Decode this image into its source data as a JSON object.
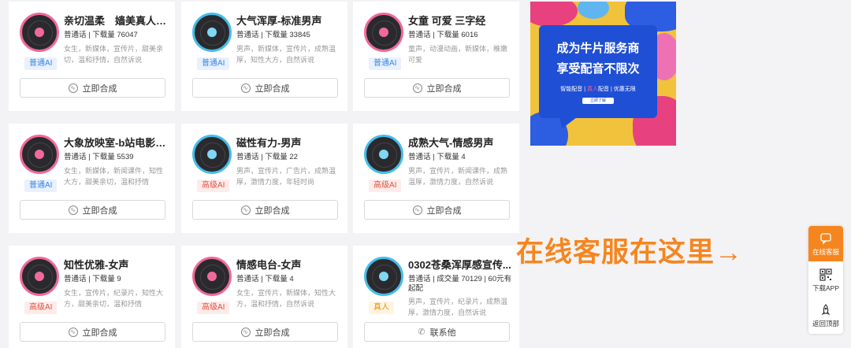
{
  "cards": [
    {
      "title": "亲切温柔　嫱美真人主播",
      "meta": "普通话 | 下载量 76047",
      "tags": "女生，新媒体，宣传片，甜美亲切，温和抒情，自然诉说",
      "badge": "普通AI",
      "badge_type": "normal",
      "ring": "pink",
      "button": "立即合成",
      "button_icon": "wave-icon"
    },
    {
      "title": "大气浑厚-标准男声",
      "meta": "普通话 | 下载量 33845",
      "tags": "男声，新媒体，宣传片，成熟温厚，知性大方，自然诉说",
      "badge": "普通AI",
      "badge_type": "normal",
      "ring": "blue",
      "button": "立即合成",
      "button_icon": "wave-icon"
    },
    {
      "title": "女童 可爱 三字经",
      "meta": "普通话 | 下载量 6016",
      "tags": "童声，动漫动画，新媒体，稚嫩可爱",
      "badge": "普通AI",
      "badge_type": "normal",
      "ring": "pink",
      "button": "立即合成",
      "button_icon": "wave-icon"
    },
    {
      "title": "大象放映室-b站电影解说",
      "meta": "普通话 | 下载量 5539",
      "tags": "女生，新媒体，新闻课件，知性大方，甜美亲切，温和抒情",
      "badge": "普通AI",
      "badge_type": "normal",
      "ring": "pink",
      "button": "立即合成",
      "button_icon": "wave-icon"
    },
    {
      "title": "磁性有力-男声",
      "meta": "普通话 | 下载量 22",
      "tags": "男声，宣传片，广告片，成熟温厚，激情力度，年轻时尚",
      "badge": "高级AI",
      "badge_type": "premium",
      "ring": "blue",
      "button": "立即合成",
      "button_icon": "wave-icon"
    },
    {
      "title": "成熟大气-情感男声",
      "meta": "普通话 | 下载量 4",
      "tags": "男声，宣传片，新闻课件，成熟温厚，激情力度，自然诉说",
      "badge": "高级AI",
      "badge_type": "premium",
      "ring": "blue",
      "button": "立即合成",
      "button_icon": "wave-icon"
    },
    {
      "title": "知性优雅-女声",
      "meta": "普通话 | 下载量 9",
      "tags": "女生，宣传片，纪录片，知性大方，甜美亲切，温和抒情",
      "badge": "高级AI",
      "badge_type": "premium",
      "ring": "pink",
      "button": "立即合成",
      "button_icon": "wave-icon"
    },
    {
      "title": "情感电台-女声",
      "meta": "普通话 | 下载量 4",
      "tags": "女生，宣传片，新媒体，知性大方，温和抒情，自然诉说",
      "badge": "高级AI",
      "badge_type": "premium",
      "ring": "pink",
      "button": "立即合成",
      "button_icon": "wave-icon"
    },
    {
      "title": "0302苍桑浑厚感宣传...",
      "meta": "普通话 | 成交量 70129 | 60元有起配",
      "tags": "男声，宣传片，纪录片，成熟温厚，激情力度，自然诉说",
      "badge": "真人",
      "badge_type": "real",
      "ring": "blue",
      "button": "联系他",
      "button_icon": "phone-icon"
    }
  ],
  "ad": {
    "line1": "成为牛片服务商",
    "line2": "享受配音不限次",
    "line3_a": "智能配音 | ",
    "line3_b": "真人",
    "line3_c": "配音 | 优惠无限",
    "cta": "立即了解"
  },
  "service_text": "在线客服在这里→",
  "sidebar": [
    {
      "label": "在线客服",
      "icon": "chat-icon",
      "active": true
    },
    {
      "label": "下载APP",
      "icon": "qr-code-icon",
      "active": false
    },
    {
      "label": "返回顶部",
      "icon": "rocket-icon",
      "active": false
    }
  ],
  "colors": {
    "pink_ring": "#f06a98",
    "blue_ring": "#46bde8",
    "accent": "#f5861f",
    "ad_blue": "#1f4fd4",
    "ad_yellow": "#f1c33d"
  }
}
